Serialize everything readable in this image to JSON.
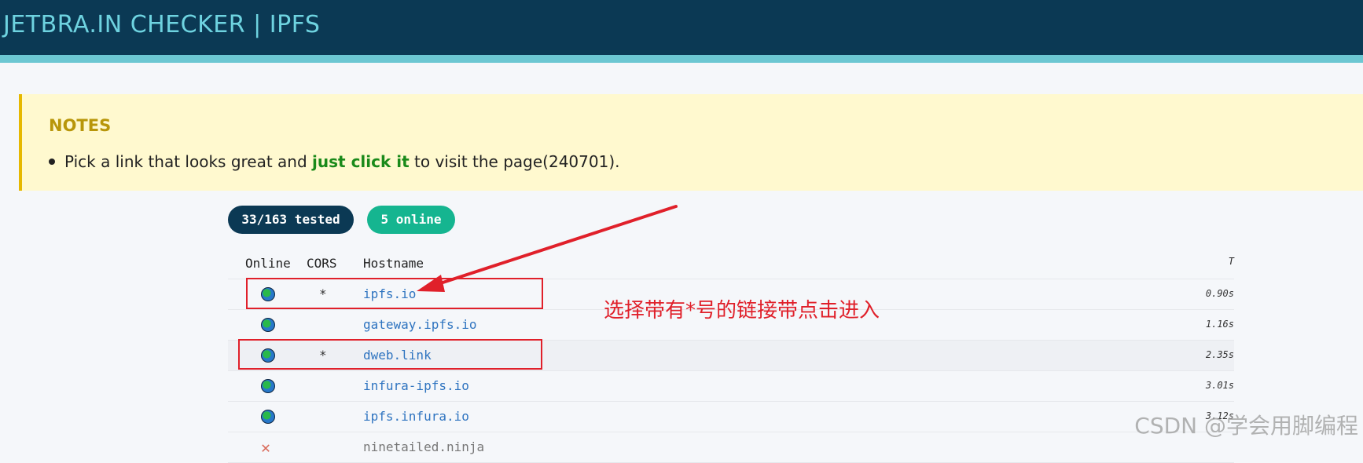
{
  "header": {
    "title": "JETBRA.IN CHECKER | IPFS"
  },
  "notes": {
    "title": "NOTES",
    "line_prefix": "Pick a link that looks great and ",
    "line_highlight": "just click it",
    "line_suffix": " to visit the page(240701)."
  },
  "badges": {
    "tested": "33/163 tested",
    "online": "5 online"
  },
  "table": {
    "columns": {
      "online": "Online",
      "cors": "CORS",
      "hostname": "Hostname",
      "time": "T"
    },
    "rows": [
      {
        "online": true,
        "cors": "*",
        "hostname": "ipfs.io",
        "time": "0.90s"
      },
      {
        "online": true,
        "cors": "",
        "hostname": "gateway.ipfs.io",
        "time": "1.16s"
      },
      {
        "online": true,
        "cors": "*",
        "hostname": "dweb.link",
        "time": "2.35s"
      },
      {
        "online": true,
        "cors": "",
        "hostname": "infura-ipfs.io",
        "time": "3.01s"
      },
      {
        "online": true,
        "cors": "",
        "hostname": "ipfs.infura.io",
        "time": "3.12s"
      },
      {
        "online": false,
        "cors": "",
        "hostname": "ninetailed.ninja",
        "time": ""
      }
    ]
  },
  "annotation": {
    "text": "选择带有*号的链接带点击进入"
  },
  "watermark": "CSDN @学会用脚编程",
  "colors": {
    "header_bg": "#0b3954",
    "header_text": "#6ed3e0",
    "stripe": "#6cc7d2",
    "notes_bg": "#fff9cf",
    "notes_border": "#e6b800",
    "link": "#2f74c0",
    "online_badge": "#15b590",
    "annotation_red": "#e0202a"
  }
}
